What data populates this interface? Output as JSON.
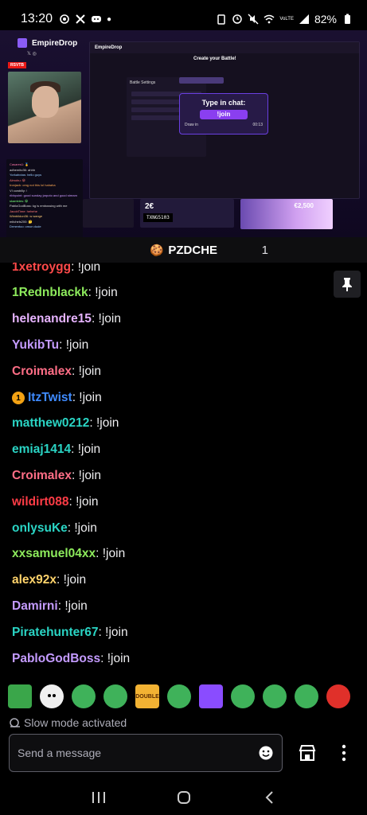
{
  "status_bar": {
    "time": "13:20",
    "battery": "82%",
    "network_label": "VoLTE"
  },
  "stream_overlay": {
    "brand": "EmpireDrop",
    "live_tag": "RSVTB",
    "site_heading": "Create your Battle!",
    "panel_title": "Battle Settings",
    "type_in_chat": "Type in chat:",
    "join_command": "!join",
    "draw_in": "Draw in",
    "timer": "00:13",
    "price": "2€",
    "promo_code": "TXNG5103",
    "prize": "€2,500",
    "mini_chat": [
      "Casares1: 🥇",
      "adhemito36: ahhh",
      "Yorkalrotas: hello guys",
      "Almobu: 😀",
      "Ironjack: omg not this lol hahaha",
      "VI cowbilly: !",
      "ribbpoint: good sunday jarpoto and good stream",
      "skambles: 😀",
      "PabloGodBoss: kg is embossing with me",
      "JacobTime: hehehe",
      "Wimblidon36: w wange",
      "mitchels200: 🤔",
      "Drmentoo: cmon dude"
    ]
  },
  "channel": {
    "emoji": "🍪",
    "name": "PZDCHE",
    "viewer_count": "1"
  },
  "chat": {
    "messages": [
      {
        "user": "1xetroygg",
        "text": ": !join",
        "color": "#ff4a4a",
        "badge": false
      },
      {
        "user": "1Rednblackk",
        "text": ": !join",
        "color": "#8dea5c",
        "badge": false
      },
      {
        "user": "helenandre15",
        "text": ": !join",
        "color": "#e6b3ff",
        "badge": false
      },
      {
        "user": "YukibTu",
        "text": ": !join",
        "color": "#c49bff",
        "badge": false
      },
      {
        "user": "Croimalex",
        "text": ": !join",
        "color": "#ff6e86",
        "badge": false
      },
      {
        "user": "ItzTwist",
        "text": ": !join",
        "color": "#3f8bff",
        "badge": true
      },
      {
        "user": "matthew0212",
        "text": ": !join",
        "color": "#2ad4c4",
        "badge": false
      },
      {
        "user": "emiaj1414",
        "text": ": !join",
        "color": "#2ad4c4",
        "badge": false
      },
      {
        "user": "Croimalex",
        "text": ": !join",
        "color": "#ff6e86",
        "badge": false
      },
      {
        "user": "wildirt088",
        "text": ": !join",
        "color": "#ff3c46",
        "badge": false
      },
      {
        "user": "onlysuKe",
        "text": ": !join",
        "color": "#2ad4c4",
        "badge": false
      },
      {
        "user": "xxsamuel04xx",
        "text": ": !join",
        "color": "#8dea5c",
        "badge": false
      },
      {
        "user": "alex92x",
        "text": ": !join",
        "color": "#ffd36b",
        "badge": false
      },
      {
        "user": "Damirni",
        "text": ": !join",
        "color": "#c49bff",
        "badge": false
      },
      {
        "user": "Piratehunter67",
        "text": ": !join",
        "color": "#2ad4c4",
        "badge": false
      },
      {
        "user": "PabloGodBoss",
        "text": ": !join",
        "color": "#c49bff",
        "badge": false
      }
    ],
    "badge_label": "1"
  },
  "emotes": [
    {
      "name": "emote-green-brush",
      "color": "#3aa64a"
    },
    {
      "name": "emote-ghost",
      "color": "#f0f0f0"
    },
    {
      "name": "emote-frog-globe",
      "color": "#3fb25a"
    },
    {
      "name": "emote-frog-laugh",
      "color": "#3fb25a"
    },
    {
      "name": "emote-double",
      "color": "#f2b233",
      "label": "DOUBLE"
    },
    {
      "name": "emote-frog",
      "color": "#3fb25a"
    },
    {
      "name": "emote-purple-crown",
      "color": "#8a4cff"
    },
    {
      "name": "emote-frog-smile",
      "color": "#3fb25a"
    },
    {
      "name": "emote-frog-eyes",
      "color": "#3fb25a"
    },
    {
      "name": "emote-frog-happy",
      "color": "#3fb25a"
    },
    {
      "name": "emote-red",
      "color": "#e0302a"
    }
  ],
  "slow_mode": "Slow mode activated",
  "input": {
    "placeholder": "Send a message"
  }
}
